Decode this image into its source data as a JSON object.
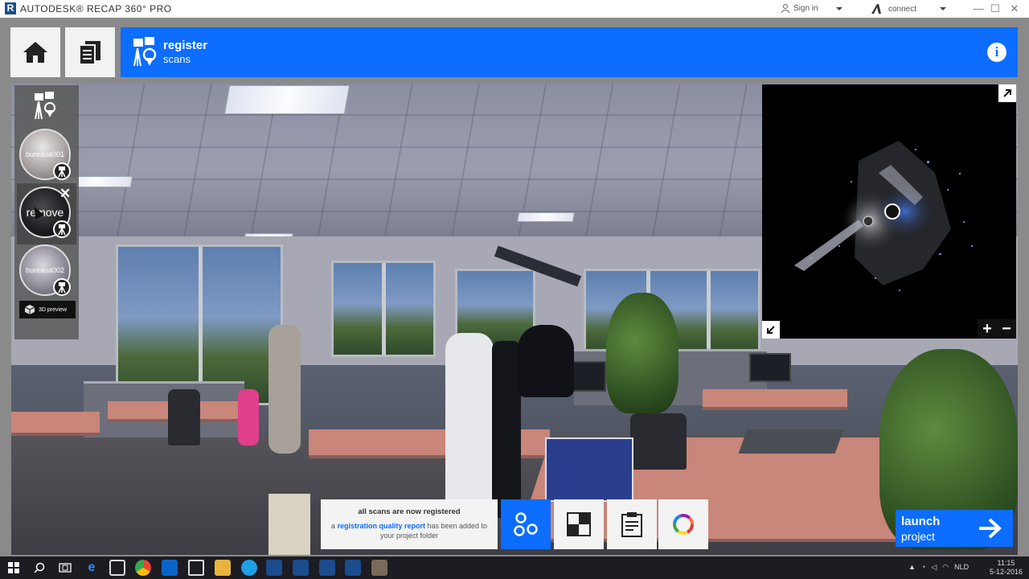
{
  "window": {
    "app_title": "AUTODESK® RECAP 360° PRO",
    "signin_label": "Sign in",
    "connect_label": "connect",
    "minimize": "—",
    "maximize": "☐",
    "close": "✕"
  },
  "header": {
    "title": "register",
    "subtitle": "scans",
    "info_label": "i",
    "icon": "register-scans-icon",
    "accent_color": "#0c6dff"
  },
  "scans": [
    {
      "label": "bureaua001"
    },
    {
      "label": "remove"
    },
    {
      "label": "bureaua002"
    }
  ],
  "preview_3d_label": "3D preview",
  "minimap": {
    "zoom_in": "+",
    "zoom_out": "−"
  },
  "notice": {
    "title": "all scans are now registered",
    "pre": "a",
    "link": "registration quality report",
    "post": "has been added to",
    "post2": "your project folder"
  },
  "toolbar_icons": [
    "scan-links-icon",
    "checkerboard-icon",
    "report-clipboard-icon",
    "color-wheel-icon"
  ],
  "launch": {
    "line1": "launch",
    "line2": "project"
  },
  "taskbar": {
    "lang": "NLD",
    "time": "11:15",
    "date": "5-12-2016"
  }
}
